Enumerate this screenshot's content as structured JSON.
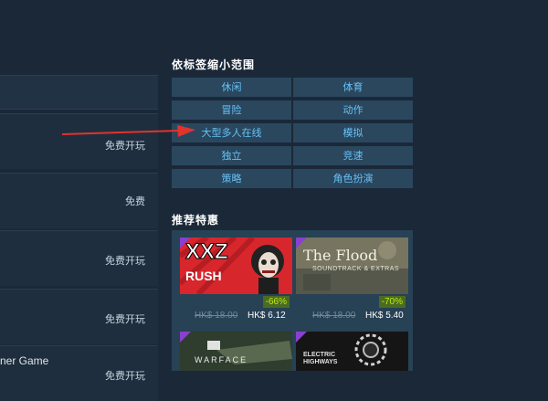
{
  "header": {
    "squares": 3
  },
  "left_list": {
    "rows": [
      {
        "price": "免费开玩"
      },
      {
        "price": "免费"
      },
      {
        "price": "免费开玩"
      },
      {
        "price": "免费开玩"
      },
      {
        "title_fragment": "ner Game",
        "price": "免费开玩"
      }
    ]
  },
  "tags_section": {
    "heading": "依标签缩小范围",
    "tags": [
      "休闲",
      "体育",
      "冒险",
      "动作",
      "大型多人在线",
      "模拟",
      "独立",
      "竞速",
      "策略",
      "角色扮演"
    ]
  },
  "recommended": {
    "heading": "推荐特惠",
    "items": [
      {
        "capsule_text_main": "XXZ",
        "capsule_text_sub": "RUSH",
        "discount": "-66%",
        "original_price": "HK$ 18.00",
        "final_price": "HK$ 6.12"
      },
      {
        "capsule_text_main": "The Flood",
        "capsule_text_sub": "SOUNDTRACK & EXTRAS",
        "discount": "-70%",
        "original_price": "HK$ 18.00",
        "final_price": "HK$ 5.40"
      },
      {
        "capsule_text_main": "WARFACE"
      },
      {
        "capsule_text_main": "ELECTRIC HIGHWAYS"
      }
    ]
  },
  "colors": {
    "background": "#1b2838",
    "tag_bg": "#2a475e",
    "tag_text": "#67c1f5",
    "discount_green": "#beee11",
    "arrow_red": "#e0342c"
  }
}
